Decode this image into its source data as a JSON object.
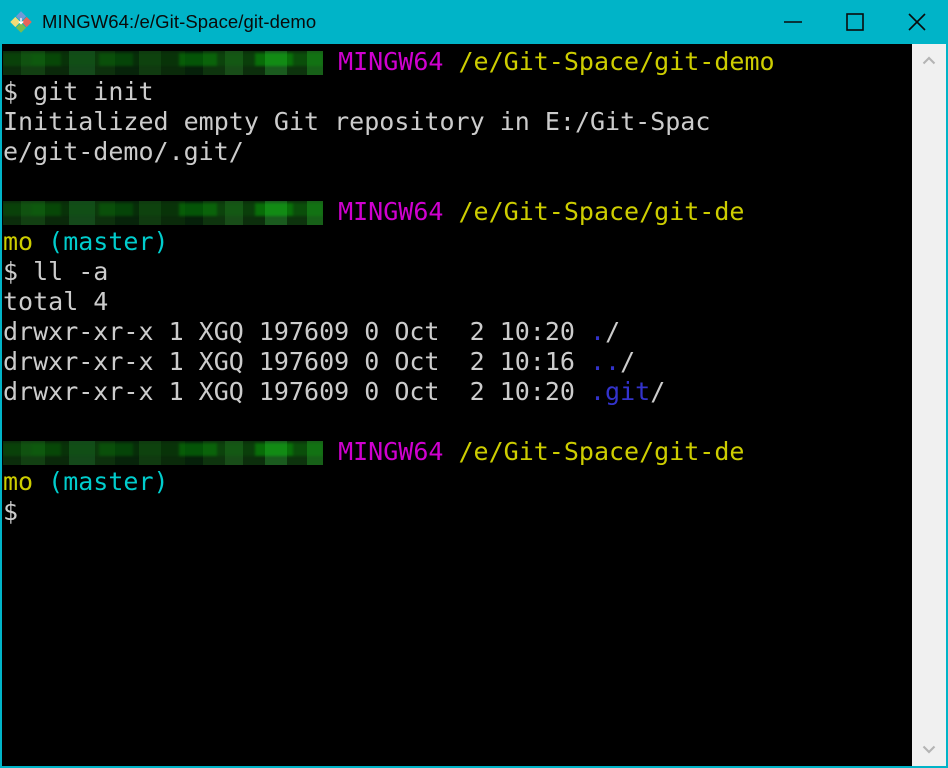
{
  "window": {
    "title": "MINGW64:/e/Git-Space/git-demo",
    "icon": "git-bash-icon",
    "accent_color": "#00b4c8",
    "background_color": "#000000"
  },
  "titlebar_buttons": {
    "minimize": {
      "name": "minimize-button",
      "glyph": "—"
    },
    "maximize": {
      "name": "maximize-button",
      "glyph": "□"
    },
    "close": {
      "name": "close-button",
      "glyph": "×"
    }
  },
  "scrollbar": {
    "up_arrow": "⌃",
    "down_arrow": "⌄",
    "track_color": "#f0f0f0"
  },
  "terminal": {
    "colors": {
      "foreground": "#cccccc",
      "magenta": "#d000d0",
      "yellow": "#cdcd00",
      "cyan": "#00cdcd",
      "blue": "#3333cc",
      "green": "#00c000"
    },
    "prompt1": {
      "user_host": "[redacted]",
      "shell": "MINGW64",
      "path": "/e/Git-Space/git-demo"
    },
    "cmd1": "$ git init",
    "out1_a": "Initialized empty Git repository in E:/Git-Spac",
    "out1_b": "e/git-demo/.git/",
    "prompt2": {
      "user_host": "[redacted]",
      "shell": "MINGW64",
      "path": "/e/Git-Space/git-de",
      "path_wrap": "mo ",
      "branch": "(master)"
    },
    "cmd2": "$ ll -a",
    "out2_total": "total 4",
    "listing": [
      {
        "perms": "drwxr-xr-x 1 XGQ 197609 0 Oct  2 10:20 ",
        "name": ".",
        "slash": "/"
      },
      {
        "perms": "drwxr-xr-x 1 XGQ 197609 0 Oct  2 10:16 ",
        "name": "..",
        "slash": "/"
      },
      {
        "perms": "drwxr-xr-x 1 XGQ 197609 0 Oct  2 10:20 ",
        "name": ".git",
        "slash": "/"
      }
    ],
    "prompt3": {
      "user_host": "[redacted]",
      "shell": "MINGW64",
      "path": "/e/Git-Space/git-de",
      "path_wrap": "mo ",
      "branch": "(master)"
    },
    "cursor_line": "$"
  }
}
